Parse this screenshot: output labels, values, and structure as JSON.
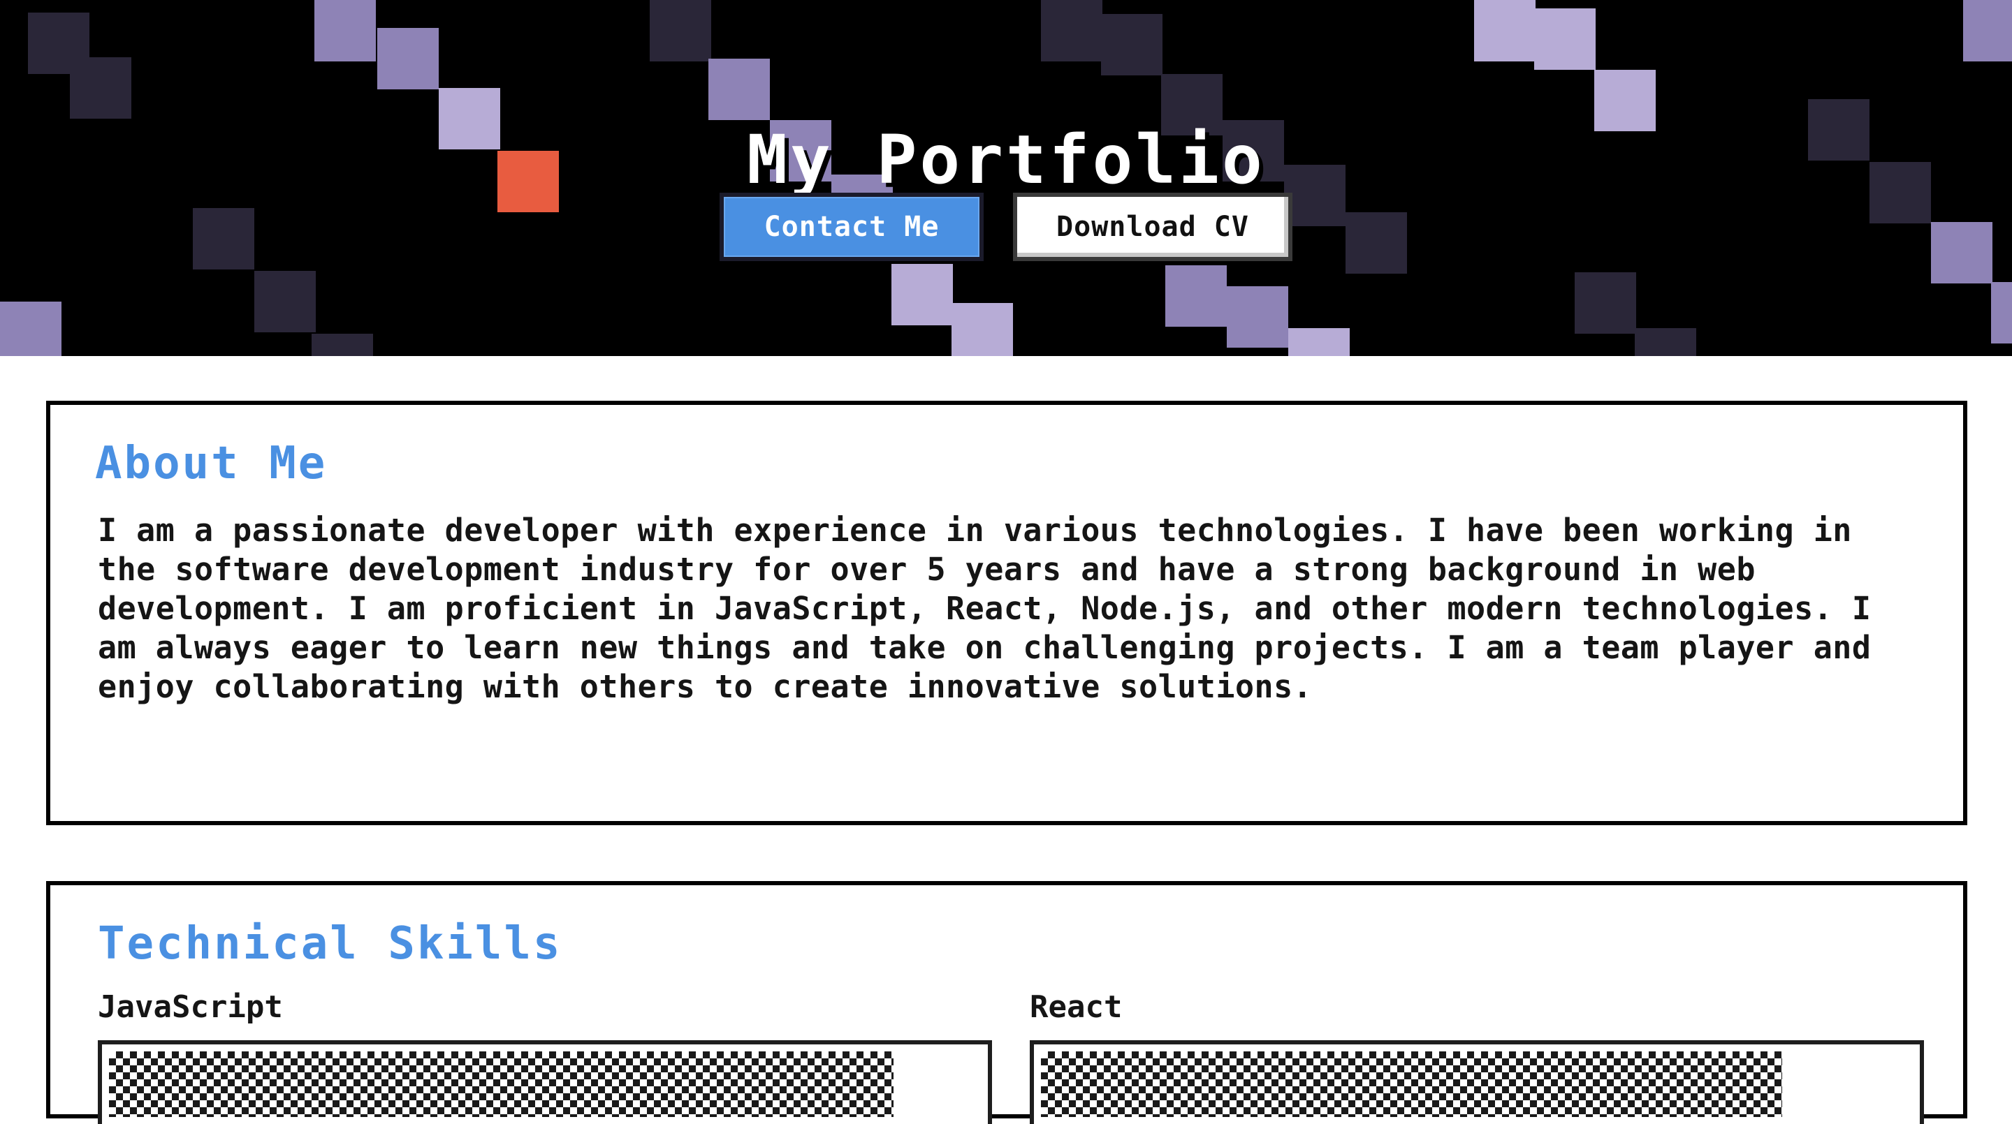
{
  "hero": {
    "title": "My Portfolio",
    "contact_label": "Contact Me",
    "download_label": "Download CV"
  },
  "about": {
    "heading": "About Me",
    "text": "I am a passionate developer with experience in various technologies. I have been working in the software development industry for over 5 years and have a strong background in web development. I am proficient in JavaScript, React, Node.js, and other modern technologies. I am always eager to learn new things and take on challenging projects. I am a team player and enjoy collaborating with others to create innovative solutions."
  },
  "skills": {
    "heading": "Technical Skills",
    "items": [
      {
        "name": "JavaScript",
        "level": 0.9
      },
      {
        "name": "React",
        "level": 0.85
      }
    ]
  },
  "colors": {
    "accent": "#4a90e2",
    "pixel_light": "#b7acd6",
    "pixel_mid": "#8e83b6",
    "pixel_dark": "#2a2638",
    "pixel_orange": "#e85c40"
  }
}
